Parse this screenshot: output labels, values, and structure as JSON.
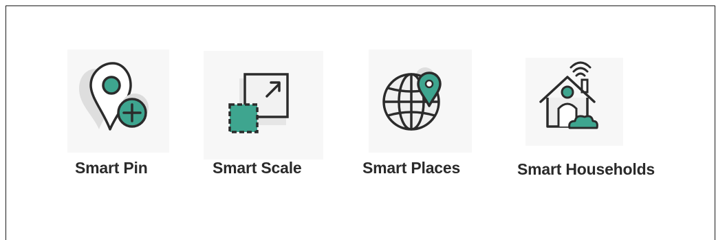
{
  "colors": {
    "accent": "#3ea58f",
    "stroke": "#2b2b2b",
    "shadow": "#d9d9d9",
    "tile": "#f7f7f7"
  },
  "features": [
    {
      "label": "Smart Pin",
      "icon": "map-pin-plus-icon"
    },
    {
      "label": "Smart Scale",
      "icon": "resize-expand-icon"
    },
    {
      "label": "Smart Places",
      "icon": "globe-location-icon"
    },
    {
      "label": "Smart Households",
      "icon": "smart-home-icon"
    }
  ]
}
